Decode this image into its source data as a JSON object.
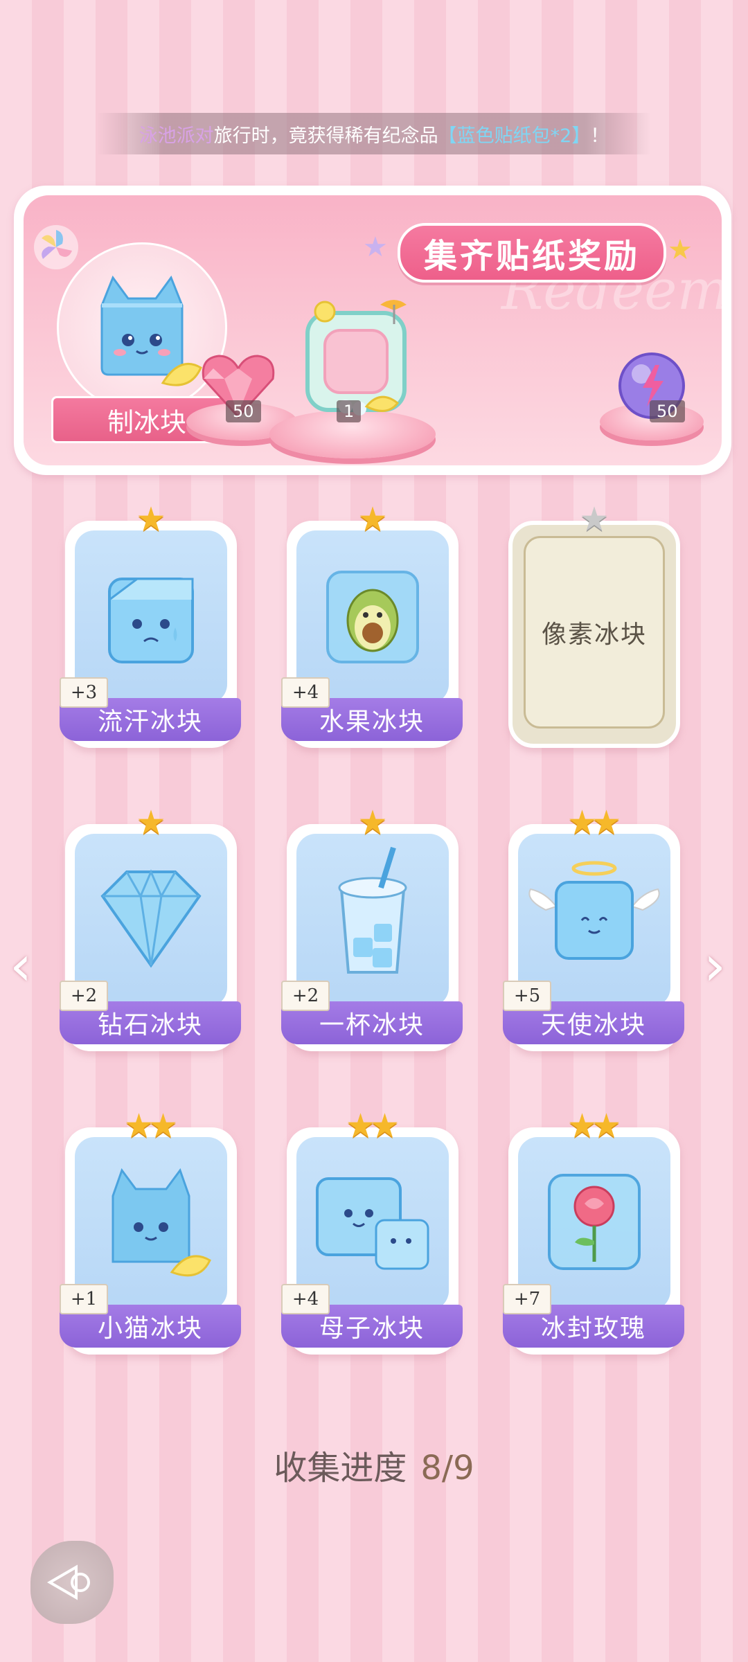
{
  "notification": {
    "place": "泳池派对",
    "middle": "旅行时，竟获得稀有纪念品",
    "item": "【蓝色贴纸包*2】",
    "end": "！"
  },
  "reward_panel": {
    "title": "集齐贴纸奖励",
    "watermark": "Redeem",
    "make_label": "制冰块",
    "rewards": [
      {
        "icon": "heart-gem-icon",
        "count": "50"
      },
      {
        "icon": "photo-frame-icon",
        "count": "1"
      },
      {
        "icon": "energy-orb-icon",
        "count": "50"
      }
    ]
  },
  "cards": [
    {
      "name": "流汗冰块",
      "plus": "+3",
      "stars": 1,
      "icon": "sweating-ice-cube-icon",
      "locked": false
    },
    {
      "name": "水果冰块",
      "plus": "+4",
      "stars": 1,
      "icon": "avocado-ice-cube-icon",
      "locked": false
    },
    {
      "name": "像素冰块",
      "plus": "",
      "stars": 1,
      "icon": "locked-card-icon",
      "locked": true
    },
    {
      "name": "钻石冰块",
      "plus": "+2",
      "stars": 1,
      "icon": "diamond-ice-icon",
      "locked": false
    },
    {
      "name": "一杯冰块",
      "plus": "+2",
      "stars": 1,
      "icon": "ice-cup-icon",
      "locked": false
    },
    {
      "name": "天使冰块",
      "plus": "+5",
      "stars": 2,
      "icon": "angel-ice-cube-icon",
      "locked": false
    },
    {
      "name": "小猫冰块",
      "plus": "+1",
      "stars": 2,
      "icon": "cat-ice-cube-icon",
      "locked": false
    },
    {
      "name": "母子冰块",
      "plus": "+4",
      "stars": 2,
      "icon": "mother-child-ice-icon",
      "locked": false
    },
    {
      "name": "冰封玫瑰",
      "plus": "+7",
      "stars": 2,
      "icon": "frozen-rose-icon",
      "locked": false
    }
  ],
  "progress": {
    "label": "收集进度",
    "value": "8/9"
  }
}
